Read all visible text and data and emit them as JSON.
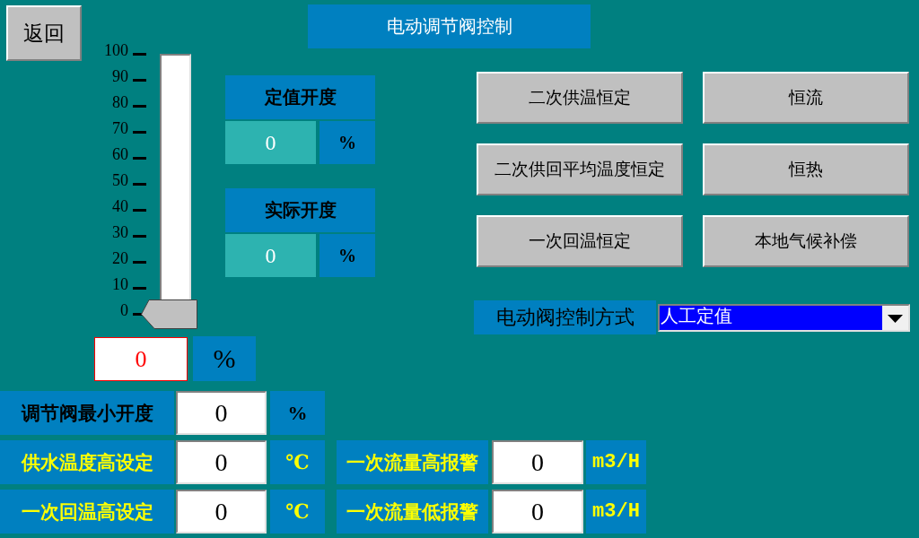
{
  "back_button": {
    "label": "返回"
  },
  "title": "电动调节阀控制",
  "valve_gauge": {
    "scale_labels": [
      "100",
      "90",
      "80",
      "70",
      "60",
      "50",
      "40",
      "30",
      "20",
      "10",
      "0"
    ],
    "level": 0
  },
  "opening_panels": [
    {
      "label": "定值开度",
      "value": "0",
      "unit": "%"
    },
    {
      "label": "实际开度",
      "value": "0",
      "unit": "%"
    }
  ],
  "mode_buttons": [
    {
      "label": "二次供温恒定"
    },
    {
      "label": "恒流"
    },
    {
      "label": "二次供回平均温度恒定"
    },
    {
      "label": "恒热"
    },
    {
      "label": "一次回温恒定"
    },
    {
      "label": "本地气候补偿"
    }
  ],
  "control_mode": {
    "label": "电动阀控制方式",
    "value": "人工定值"
  },
  "opening_input": {
    "value": "0",
    "unit": "%"
  },
  "settings": [
    {
      "label": "调节阀最小开度",
      "value": "0",
      "unit": "%",
      "color": "#000000"
    },
    {
      "label": "供水温度高设定",
      "value": "0",
      "unit": "℃",
      "color": "#ffff00"
    },
    {
      "label": "一次回温高设定",
      "value": "0",
      "unit": "℃",
      "color": "#ffff00"
    }
  ],
  "flow_alarms": [
    {
      "label": "一次流量高报警",
      "value": "0",
      "unit": "m3/H"
    },
    {
      "label": "一次流量低报警",
      "value": "0",
      "unit": "m3/H"
    }
  ]
}
